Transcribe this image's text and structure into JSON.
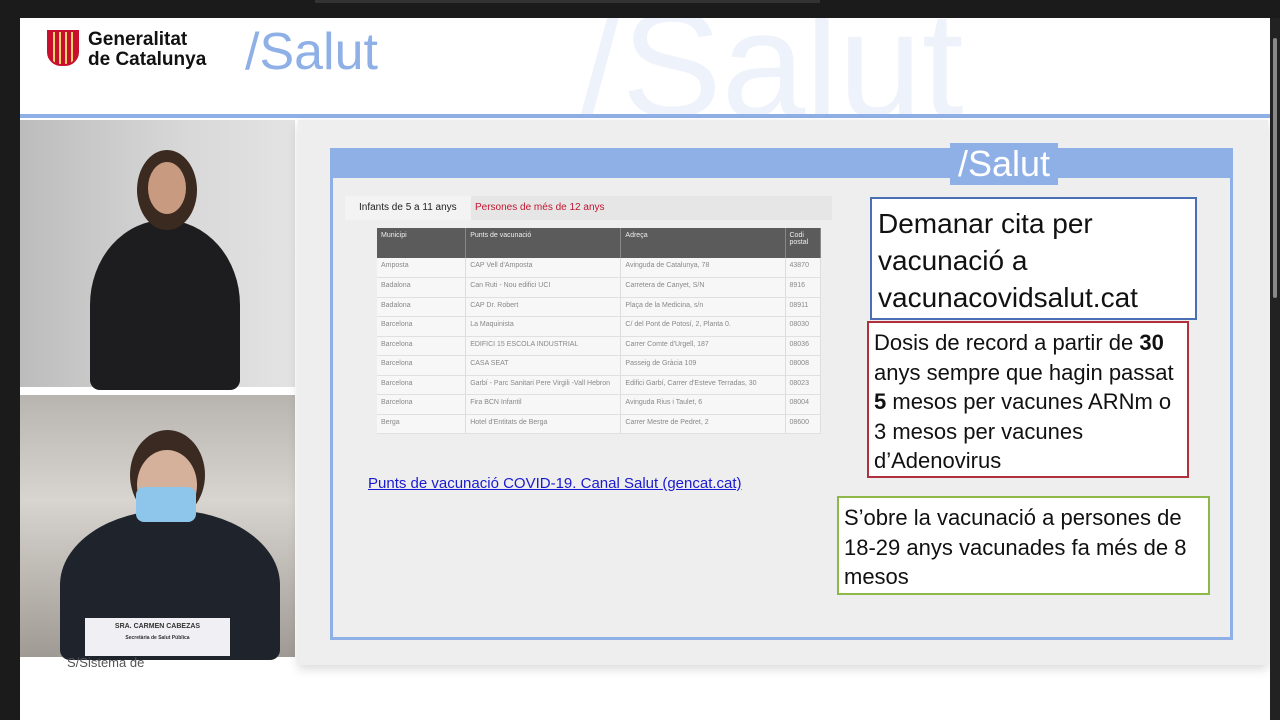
{
  "header": {
    "org_line1": "Generalitat",
    "org_line2": "de Catalunya",
    "brand": "/Salut",
    "brand_watermark": "/Salut"
  },
  "presenter": {
    "name": "SRA. CARMEN CABEZAS",
    "role": "Secretària de Salut Pública",
    "footer_text": "S/Sistema de"
  },
  "slide": {
    "brand": "/Salut",
    "tabs": [
      {
        "label": "Infants de 5 a 11 anys"
      },
      {
        "label": "Persones de més de 12 anys"
      }
    ],
    "table": {
      "headers": [
        "Municipi",
        "Punts de vacunació",
        "Adreça",
        "Codi postal"
      ],
      "rows": [
        [
          "Amposta",
          "CAP Vell d'Amposta",
          "Avinguda de Catalunya, 78",
          "43870"
        ],
        [
          "Badalona",
          "Can Ruti - Nou edifici UCI",
          "Carretera de Canyet, S/N",
          "8916"
        ],
        [
          "Badalona",
          "CAP Dr. Robert",
          "Plaça de la Medicina, s/n",
          "08911"
        ],
        [
          "Barcelona",
          "La Maquinista",
          "C/ del Pont de Potosí, 2, Planta 0.",
          "08030"
        ],
        [
          "Barcelona",
          "EDIFICI 15 ESCOLA INDUSTRIAL",
          "Carrer Comte d'Urgell, 187",
          "08036"
        ],
        [
          "Barcelona",
          "CASA SEAT",
          "Passeig de Gràcia 109",
          "08008"
        ],
        [
          "Barcelona",
          "Garbí - Parc Sanitari Pere Virgili -Vall Hebron",
          "Edifici Garbí, Carrer d'Esteve Terradas, 30",
          "08023"
        ],
        [
          "Barcelona",
          "Fira BCN Infantil",
          "Avinguda Rius i Taulet, 6",
          "08004"
        ],
        [
          "Berga",
          "Hotel d'Entitats de Berga",
          "Carrer Mestre de Pedret, 2",
          "08600"
        ]
      ]
    },
    "link": "Punts de vacunació COVID-19. Canal Salut (gencat.cat)",
    "box1": "Demanar cita per vacunació a vacunacovidsalut.cat",
    "box2": {
      "t1": "Dosis de record a partir de ",
      "b1": "30",
      "t2": " anys sempre que hagin passat ",
      "b2": "5",
      "t3": " mesos per vacunes ARNm o 3 mesos per vacunes d’Adenovirus"
    },
    "box3": "S’obre la vacunació a persones de 18-29 anys vacunades fa més de 8 mesos"
  }
}
